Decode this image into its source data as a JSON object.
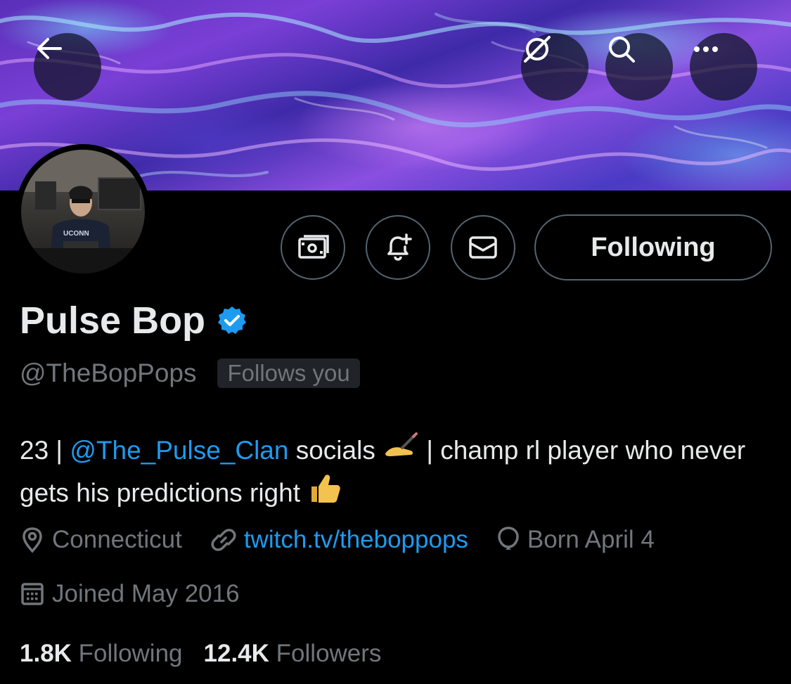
{
  "profile": {
    "display_name": "Pulse Bop",
    "handle": "@TheBopPops",
    "follows_you": "Follows you",
    "verified_icon": "verified-badge-icon"
  },
  "actions": {
    "following_label": "Following"
  },
  "bio": {
    "prefix": "23 | ",
    "mention": "@The_Pulse_Clan",
    "middle": " socials ",
    "after_emoji": " | champ rl player who never gets his predictions right ",
    "emoji_1": "writing-hand",
    "emoji_2": "thumbs-up"
  },
  "meta": {
    "location": "Connecticut",
    "link": "twitch.tv/theboppops",
    "birthday": "Born April 4",
    "joined": "Joined May 2016"
  },
  "stats": {
    "following_count": "1.8K",
    "following_label": "Following",
    "followers_count": "12.4K",
    "followers_label": "Followers"
  },
  "colors": {
    "accent": "#1d9bf0",
    "muted": "#71767b",
    "border": "#536471"
  }
}
